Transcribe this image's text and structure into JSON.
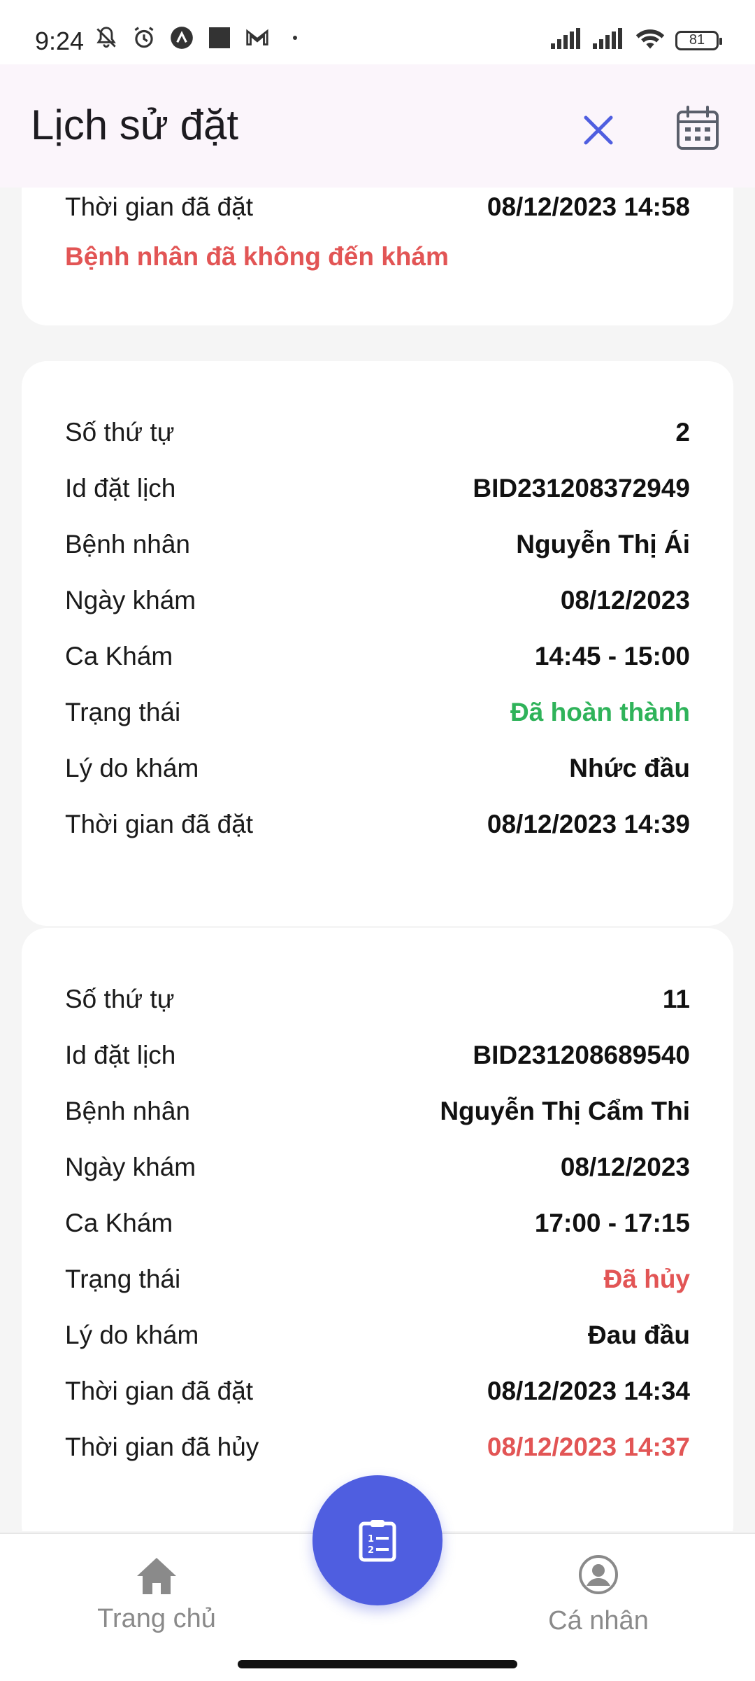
{
  "status_bar": {
    "time": "9:24",
    "battery": "81",
    "icons": [
      "mute-icon",
      "alarm-icon",
      "app-icon",
      "square-icon",
      "gmail-icon",
      "dot-icon",
      "signal-icon",
      "signal-icon-2",
      "wifi-icon",
      "battery-icon"
    ]
  },
  "appbar": {
    "title": "Lịch sử đặt",
    "close_icon": "close-icon",
    "calendar_icon": "calendar-icon"
  },
  "partial_card": {
    "row_label": "Thời gian đã đặt",
    "row_value": "08/12/2023 14:58",
    "warning": "Bệnh nhân đã không đến khám"
  },
  "cards": [
    {
      "rows": [
        {
          "label": "Số thứ tự",
          "value": "2"
        },
        {
          "label": "Id đặt lịch",
          "value": "BID231208372949"
        },
        {
          "label": "Bệnh nhân",
          "value": "Nguyễn Thị Ái"
        },
        {
          "label": "Ngày khám",
          "value": "08/12/2023"
        },
        {
          "label": "Ca Khám",
          "value": "14:45 - 15:00"
        },
        {
          "label": "Trạng thái",
          "value": "Đã hoàn thành",
          "color": "#2fb35a"
        },
        {
          "label": "Lý do khám",
          "value": "Nhức đầu"
        },
        {
          "label": "Thời gian đã đặt",
          "value": "08/12/2023 14:39"
        }
      ]
    },
    {
      "rows": [
        {
          "label": "Số thứ tự",
          "value": "11"
        },
        {
          "label": "Id đặt lịch",
          "value": "BID231208689540"
        },
        {
          "label": "Bệnh nhân",
          "value": "Nguyễn Thị Cẩm Thi"
        },
        {
          "label": "Ngày khám",
          "value": "08/12/2023"
        },
        {
          "label": "Ca Khám",
          "value": "17:00 - 17:15"
        },
        {
          "label": "Trạng thái",
          "value": "Đã hủy",
          "color": "#e25555"
        },
        {
          "label": "Lý do khám",
          "value": "Đau đầu"
        },
        {
          "label": "Thời gian đã đặt",
          "value": "08/12/2023 14:34"
        },
        {
          "label": "Thời gian đã hủy",
          "value": "08/12/2023 14:37",
          "color": "#e25555"
        }
      ]
    }
  ],
  "bottom_nav": {
    "home_label": "Trang chủ",
    "home_icon": "home-icon",
    "profile_label": "Cá nhân",
    "profile_icon": "profile-icon",
    "fab_icon": "clipboard-list-icon"
  },
  "colors": {
    "accent": "#4f5ee0",
    "success": "#2fb35a",
    "danger": "#e25555"
  }
}
